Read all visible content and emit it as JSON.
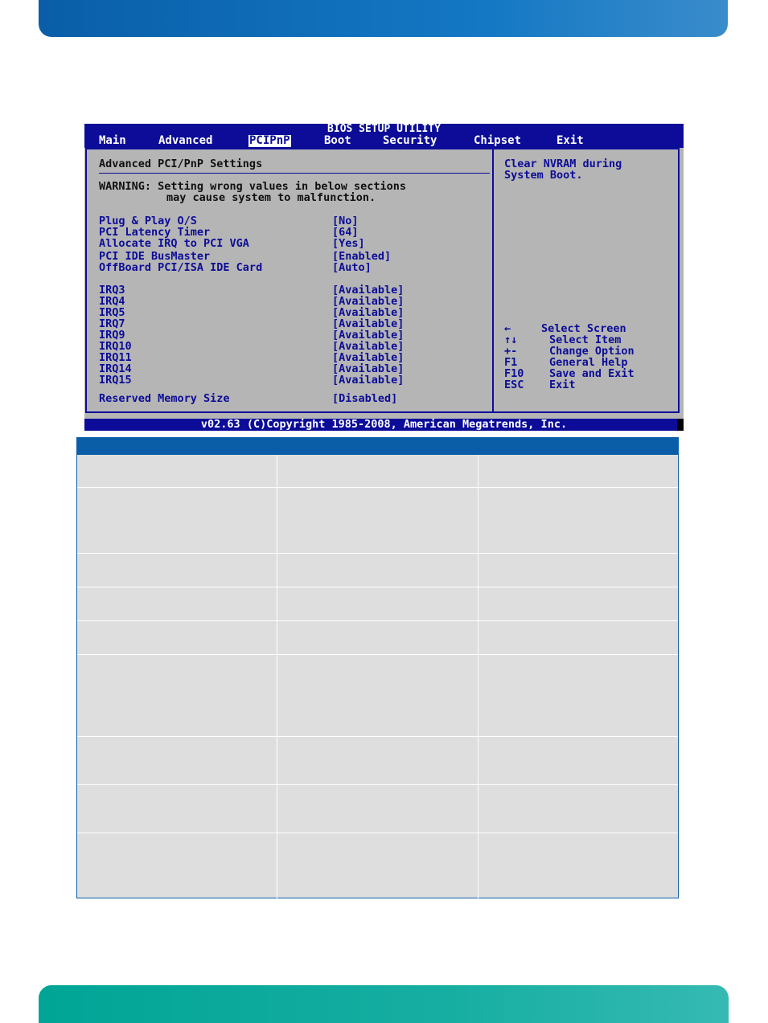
{
  "bios": {
    "title": "BIOS SETUP UTILITY",
    "tabs": [
      {
        "label": "Main",
        "active": false
      },
      {
        "label": "Advanced",
        "active": false
      },
      {
        "label": "PCIPnP",
        "active": true
      },
      {
        "label": "Boot",
        "active": false
      },
      {
        "label": "Security",
        "active": false
      },
      {
        "label": "Chipset",
        "active": false
      },
      {
        "label": "Exit",
        "active": false
      }
    ],
    "section_title": "Advanced PCI/PnP Settings",
    "warning_line1": "WARNING: Setting wrong values in below sections",
    "warning_line2": "may cause system to malfunction.",
    "settings": [
      {
        "label": "Plug & Play O/S",
        "value": "[No]"
      },
      {
        "label": "PCI Latency Timer",
        "value": "[64]"
      },
      {
        "label": "Allocate IRQ to PCI VGA",
        "value": "[Yes]"
      },
      {
        "label": "PCI IDE BusMaster",
        "value": "[Enabled]"
      },
      {
        "label": "OffBoard PCI/ISA IDE Card",
        "value": "[Auto]"
      }
    ],
    "irqs": [
      {
        "label": "IRQ3",
        "value": "[Available]"
      },
      {
        "label": "IRQ4",
        "value": "[Available]"
      },
      {
        "label": "IRQ5",
        "value": "[Available]"
      },
      {
        "label": "IRQ7",
        "value": "[Available]"
      },
      {
        "label": "IRQ9",
        "value": "[Available]"
      },
      {
        "label": "IRQ10",
        "value": "[Available]"
      },
      {
        "label": "IRQ11",
        "value": "[Available]"
      },
      {
        "label": "IRQ14",
        "value": "[Available]"
      },
      {
        "label": "IRQ15",
        "value": "[Available]"
      }
    ],
    "reserved_memory": {
      "label": "Reserved Memory Size",
      "value": "[Disabled]"
    },
    "help_line1": "Clear NVRAM during",
    "help_line2": "System Boot.",
    "keys": [
      {
        "key": "←",
        "action": "Select Screen"
      },
      {
        "key": "↑↓",
        "action": "Select Item"
      },
      {
        "key": "+-",
        "action": "Change Option"
      },
      {
        "key": "F1",
        "action": "General Help"
      },
      {
        "key": "F10",
        "action": "Save and Exit"
      },
      {
        "key": "ESC",
        "action": "Exit"
      }
    ],
    "footer": "v02.63 (C)Copyright 1985-2008, American Megatrends, Inc."
  },
  "colors": {
    "bios_blue": "#0c0c98",
    "bios_gray": "#b5b5b5",
    "header_blue": "#0a5ea8",
    "footer_teal": "#00a596",
    "table_gray": "#dedede"
  }
}
